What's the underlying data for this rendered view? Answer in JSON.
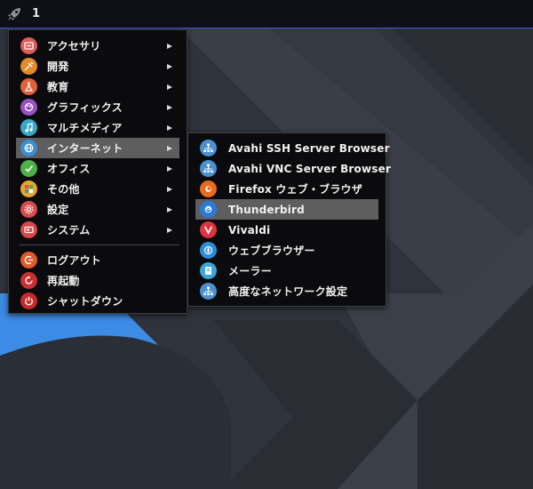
{
  "panel": {
    "workspace": "1"
  },
  "main_menu": {
    "items": [
      {
        "label": "アクセサリ",
        "icon": "accessories-icon",
        "color": "#e05a5a"
      },
      {
        "label": "開発",
        "icon": "development-icon",
        "color": "#e38a2a"
      },
      {
        "label": "教育",
        "icon": "education-icon",
        "color": "#e0603c"
      },
      {
        "label": "グラフィックス",
        "icon": "graphics-icon",
        "color": "#9b4fc7"
      },
      {
        "label": "マルチメディア",
        "icon": "multimedia-icon",
        "color": "#3aa8c8"
      },
      {
        "label": "インターネット",
        "icon": "internet-icon",
        "color": "#3a8fd0"
      },
      {
        "label": "オフィス",
        "icon": "office-icon",
        "color": "#4fb04a"
      },
      {
        "label": "その他",
        "icon": "other-icon",
        "color": "#e8a530"
      },
      {
        "label": "設定",
        "icon": "settings-icon",
        "color": "#d94a4a"
      },
      {
        "label": "システム",
        "icon": "system-icon",
        "color": "#d84848"
      }
    ],
    "actions": [
      {
        "label": "ログアウト",
        "icon": "logout-icon",
        "color": "#e05a2a"
      },
      {
        "label": "再起動",
        "icon": "reboot-icon",
        "color": "#c93030"
      },
      {
        "label": "シャットダウン",
        "icon": "shutdown-icon",
        "color": "#c82a2a"
      }
    ]
  },
  "internet_menu": {
    "items": [
      {
        "label": "Avahi SSH Server Browser",
        "icon": "network-icon",
        "color": "#4c90d0"
      },
      {
        "label": "Avahi VNC Server Browser",
        "icon": "network-icon",
        "color": "#4c90d0"
      },
      {
        "label": "Firefox ウェブ・ブラウザ",
        "icon": "firefox-icon",
        "color": "#e86a1e"
      },
      {
        "label": "Thunderbird",
        "icon": "thunderbird-icon",
        "color": "#2a7cd8"
      },
      {
        "label": "Vivaldi",
        "icon": "vivaldi-icon",
        "color": "#e0323c"
      },
      {
        "label": "ウェブブラウザー",
        "icon": "web-browser-icon",
        "color": "#2a8ed8"
      },
      {
        "label": "メーラー",
        "icon": "mailer-icon",
        "color": "#3aa6dc"
      },
      {
        "label": "高度なネットワーク設定",
        "icon": "network-settings-icon",
        "color": "#4c90d0"
      }
    ]
  },
  "colors": {
    "highlight": "#5e5e5e",
    "panel_border": "#3a5bd0",
    "wallpaper_blue": "#3c8ce6"
  }
}
